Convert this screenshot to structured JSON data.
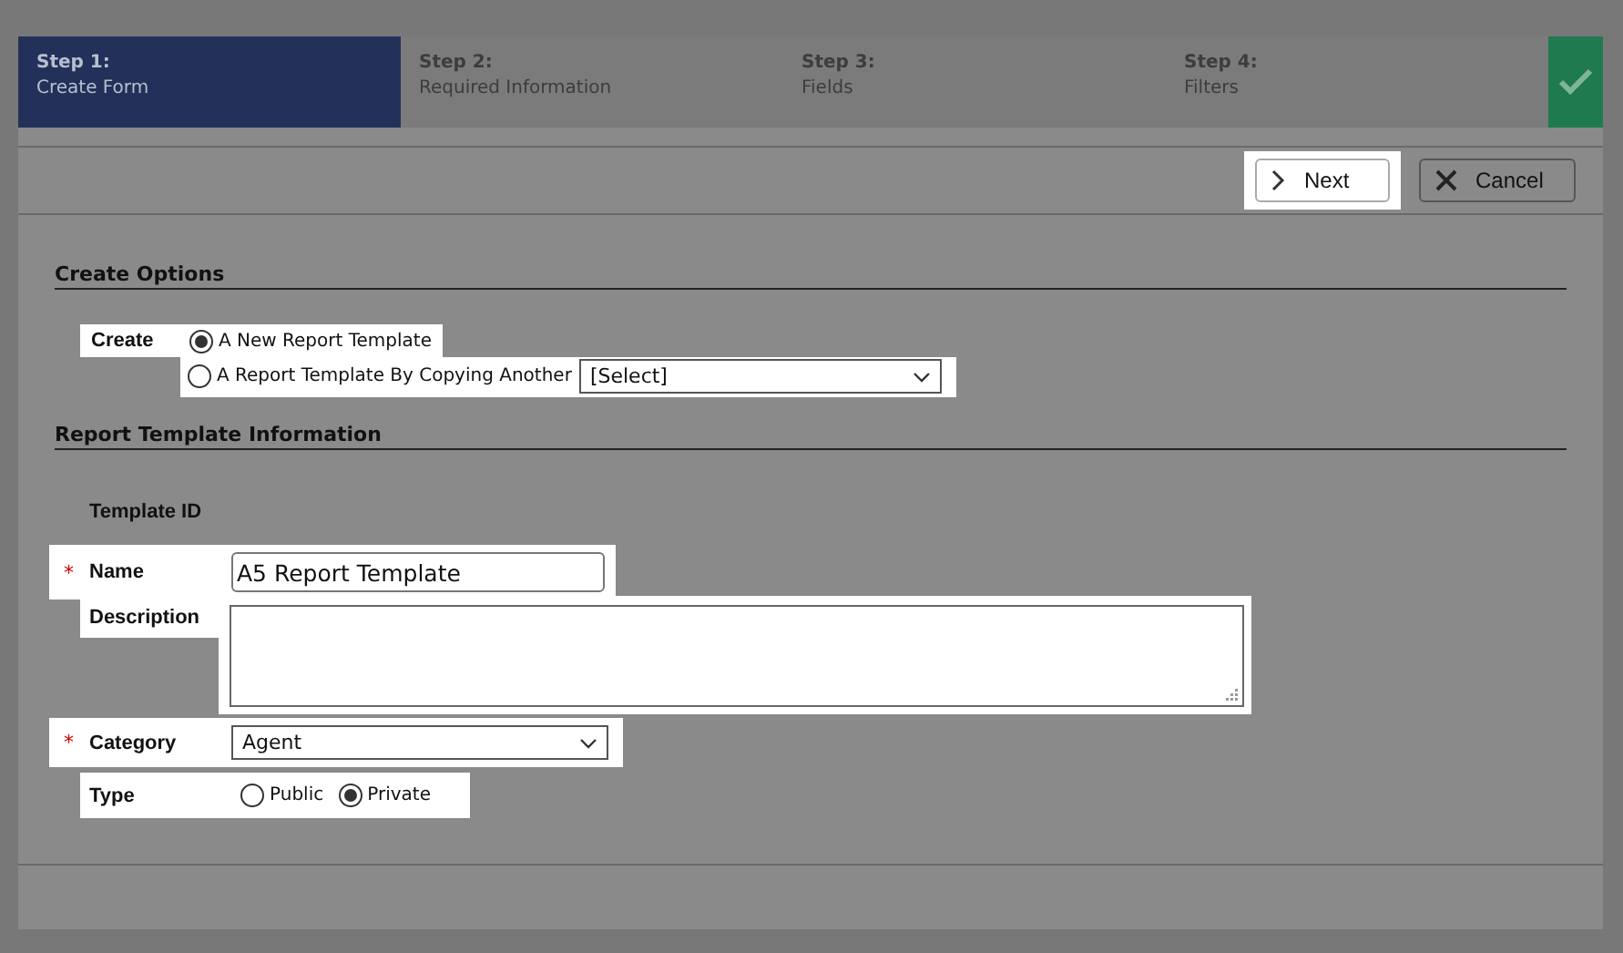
{
  "steps": [
    {
      "number": "Step 1:",
      "label": "Create Form",
      "selected": true
    },
    {
      "number": "Step 2:",
      "label": "Required Information",
      "selected": false
    },
    {
      "number": "Step 3:",
      "label": "Fields",
      "selected": false
    },
    {
      "number": "Step 4:",
      "label": "Filters",
      "selected": false
    }
  ],
  "toolbar": {
    "buttons": [
      {
        "kind": "next",
        "label": "Next",
        "highlighted": true
      },
      {
        "kind": "cancel",
        "label": "Cancel",
        "highlighted": false
      }
    ]
  },
  "create_options": {
    "heading": "Create Options",
    "label": "Create",
    "options": [
      {
        "label": "A New Report Template",
        "selected": true
      },
      {
        "label": "A Report Template By Copying Another",
        "selected": false,
        "select_value": "[Select]"
      }
    ]
  },
  "template_info": {
    "heading": "Report Template Information",
    "template_id_label": "Template ID",
    "name": {
      "required_mark": "*",
      "label": "Name",
      "value": "A5 Report Template"
    },
    "description": {
      "label": "Description"
    },
    "category": {
      "required_mark": "*",
      "label": "Category",
      "value": "Agent"
    },
    "type": {
      "label": "Type",
      "options": [
        {
          "label": "Public",
          "selected": false
        },
        {
          "label": "Private",
          "selected": true
        }
      ]
    }
  }
}
